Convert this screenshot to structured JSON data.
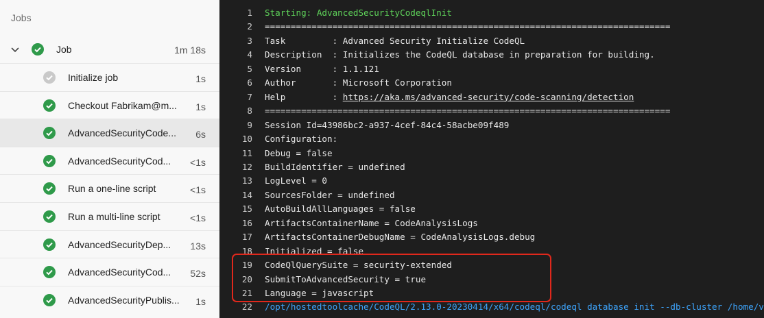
{
  "sidebar": {
    "title": "Jobs",
    "job": {
      "label": "Job",
      "duration": "1m 18s"
    },
    "steps": [
      {
        "label": "Initialize job",
        "duration": "1s",
        "status": "grey"
      },
      {
        "label": "Checkout Fabrikam@m...",
        "duration": "1s",
        "status": "success"
      },
      {
        "label": "AdvancedSecurityCode...",
        "duration": "6s",
        "status": "success",
        "selected": true
      },
      {
        "label": "AdvancedSecurityCod...",
        "duration": "<1s",
        "status": "success"
      },
      {
        "label": "Run a one-line script",
        "duration": "<1s",
        "status": "success"
      },
      {
        "label": "Run a multi-line script",
        "duration": "<1s",
        "status": "success"
      },
      {
        "label": "AdvancedSecurityDep...",
        "duration": "13s",
        "status": "success"
      },
      {
        "label": "AdvancedSecurityCod...",
        "duration": "52s",
        "status": "success"
      },
      {
        "label": "AdvancedSecurityPublis...",
        "duration": "1s",
        "status": "success"
      }
    ]
  },
  "console": {
    "lines": [
      {
        "n": "1",
        "text": "Starting: AdvancedSecurityCodeqlInit",
        "style": "green"
      },
      {
        "n": "2",
        "text": "==============================================================================",
        "style": "normal"
      },
      {
        "n": "3",
        "text": "Task         : Advanced Security Initialize CodeQL",
        "style": "normal"
      },
      {
        "n": "4",
        "text": "Description  : Initializes the CodeQL database in preparation for building.",
        "style": "normal"
      },
      {
        "n": "5",
        "text": "Version      : 1.1.121",
        "style": "normal"
      },
      {
        "n": "6",
        "text": "Author       : Microsoft Corporation",
        "style": "normal"
      },
      {
        "n": "7",
        "text": "Help         : ",
        "link": "https://aka.ms/advanced-security/code-scanning/detection",
        "style": "normal"
      },
      {
        "n": "8",
        "text": "==============================================================================",
        "style": "normal"
      },
      {
        "n": "9",
        "text": "Session Id=43986bc2-a937-4cef-84c4-58acbe09f489",
        "style": "normal"
      },
      {
        "n": "10",
        "text": "Configuration:",
        "style": "normal"
      },
      {
        "n": "11",
        "text": "Debug = false",
        "style": "normal"
      },
      {
        "n": "12",
        "text": "BuildIdentifier = undefined",
        "style": "normal"
      },
      {
        "n": "13",
        "text": "LogLevel = 0",
        "style": "normal"
      },
      {
        "n": "14",
        "text": "SourcesFolder = undefined",
        "style": "normal"
      },
      {
        "n": "15",
        "text": "AutoBuildAllLanguages = false",
        "style": "normal"
      },
      {
        "n": "16",
        "text": "ArtifactsContainerName = CodeAnalysisLogs",
        "style": "normal"
      },
      {
        "n": "17",
        "text": "ArtifactsContainerDebugName = CodeAnalysisLogs.debug",
        "style": "normal"
      },
      {
        "n": "18",
        "text": "Initialized = false",
        "style": "normal"
      },
      {
        "n": "19",
        "text": "CodeQlQuerySuite = security-extended",
        "style": "normal"
      },
      {
        "n": "20",
        "text": "SubmitToAdvancedSecurity = true",
        "style": "normal"
      },
      {
        "n": "21",
        "text": "Language = javascript",
        "style": "normal"
      },
      {
        "n": "22",
        "text": "/opt/hostedtoolcache/CodeQL/2.13.0-20230414/x64/codeql/codeql database init --db-cluster /home/vsts",
        "style": "blue"
      }
    ]
  },
  "colors": {
    "success": "#2f9a4a",
    "pending": "#c9c9c9",
    "highlight": "#e0281c",
    "log_green": "#5fd35a",
    "log_blue": "#3ea6ff"
  }
}
